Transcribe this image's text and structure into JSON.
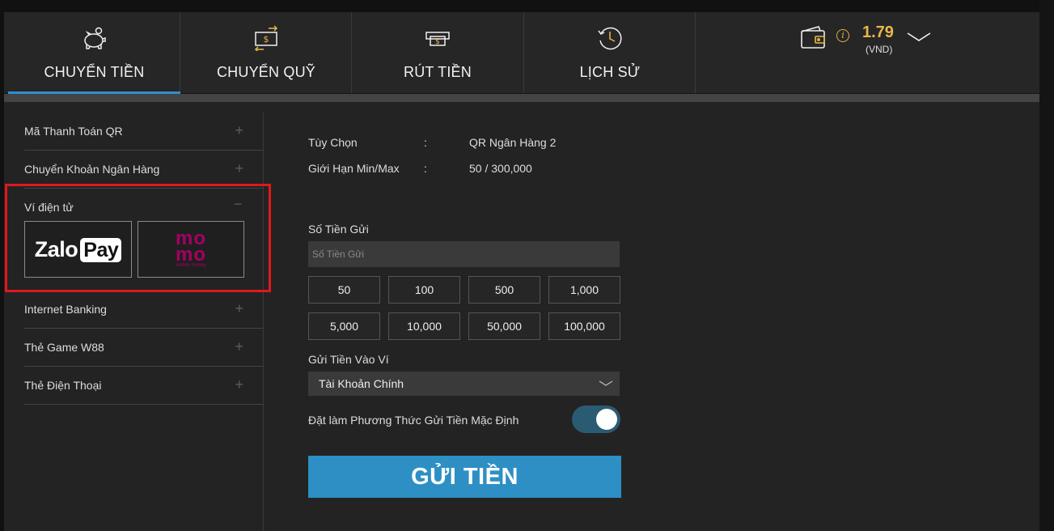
{
  "tabs": [
    {
      "label": "CHUYỂN TIỀN",
      "icon": "piggy-bank-icon",
      "active": true
    },
    {
      "label": "CHUYỂN QUỸ",
      "icon": "money-transfer-icon",
      "active": false
    },
    {
      "label": "RÚT TIỀN",
      "icon": "cash-withdraw-icon",
      "active": false
    },
    {
      "label": "LỊCH SỬ",
      "icon": "history-clock-icon",
      "active": false
    }
  ],
  "wallet": {
    "balance": "1.79",
    "currency": "(VND)",
    "info": "i"
  },
  "sidebar": {
    "items": [
      {
        "label": "Mã Thanh Toán QR",
        "toggle": "+"
      },
      {
        "label": "Chuyển Khoản Ngân Hàng",
        "toggle": "+"
      },
      {
        "label": "Ví điện tử",
        "toggle": "−"
      },
      {
        "label": "Internet Banking",
        "toggle": "+"
      },
      {
        "label": "Thẻ Game W88",
        "toggle": "+"
      },
      {
        "label": "Thẻ Điện Thoại",
        "toggle": "+"
      }
    ],
    "ewallets": {
      "zalo": {
        "brand": "Zalo",
        "suffix": "Pay"
      },
      "momo": {
        "brand_top": "mo",
        "brand_bottom": "mo",
        "tagline": "mobile money"
      }
    }
  },
  "form": {
    "option_label": "Tùy Chọn",
    "option_value": "QR Ngân Hàng 2",
    "limit_label": "Giới Hạn Min/Max",
    "limit_value": "50 / 300,000",
    "colon": ":",
    "amount_label": "Số Tiền Gửi",
    "amount_placeholder": "Số Tiền Gửi",
    "quick_amounts": [
      "50",
      "100",
      "500",
      "1,000",
      "5,000",
      "10,000",
      "50,000",
      "100,000"
    ],
    "wallet_label": "Gửi Tiền Vào Ví",
    "wallet_selected": "Tài Khoản Chính",
    "default_label": "Đặt làm Phương Thức Gửi Tiền Mặc Định",
    "submit_label": "GỬI TIỀN"
  },
  "colors": {
    "accent": "#2e8fd0",
    "submit": "#2d8fc4",
    "gold": "#e8b84a",
    "highlight": "#e0181c",
    "momo": "#a50064"
  }
}
